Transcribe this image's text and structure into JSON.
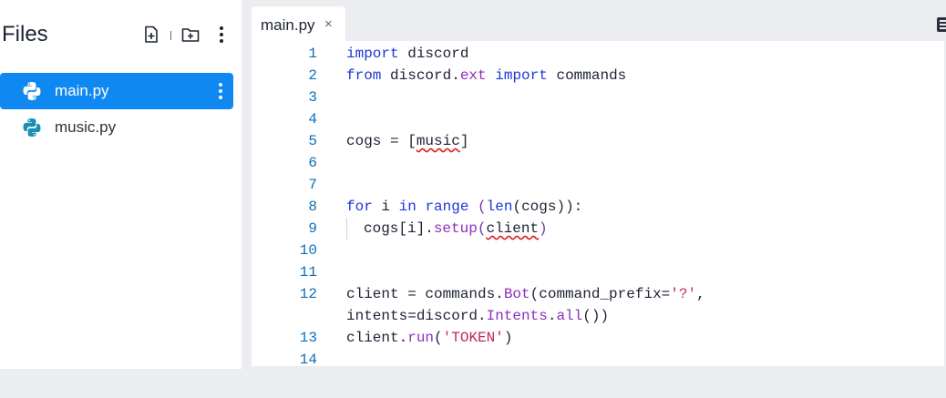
{
  "sidebar": {
    "title": "Files",
    "files": [
      {
        "name": "main.py",
        "active": true
      },
      {
        "name": "music.py",
        "active": false
      }
    ]
  },
  "tabs": [
    {
      "label": "main.py",
      "close": "×"
    }
  ],
  "editor": {
    "line_numbers": [
      "1",
      "2",
      "3",
      "4",
      "5",
      "6",
      "7",
      "8",
      "9",
      "10",
      "11",
      "12",
      "13",
      "14"
    ],
    "lines": {
      "l1": {
        "a": "import",
        "b": " discord"
      },
      "l2": {
        "a": "from",
        "b": " discord.",
        "c": "ext",
        "d": " ",
        "e": "import",
        "f": " commands"
      },
      "l5": {
        "a": "cogs = [",
        "b": "music",
        "c": "]"
      },
      "l8": {
        "a": "for",
        "b": " i ",
        "c": "in",
        "d": " ",
        "e": "range",
        "f": " (",
        "g": "len",
        "h": "(cogs)):"
      },
      "l9": {
        "a": "cogs[i].",
        "b": "setup",
        "c": "(",
        "d": "client",
        "e": ")"
      },
      "l12a": {
        "a": "client = commands.",
        "b": "Bot",
        "c": "(command_prefix=",
        "d": "'?'",
        "e": ","
      },
      "l12b": {
        "a": "intents=discord.",
        "b": "Intents",
        "c": ".",
        "d": "all",
        "e": "())"
      },
      "l13": {
        "a": "client.",
        "b": "run",
        "c": "(",
        "d": "'TOKEN'",
        "e": ")"
      }
    }
  },
  "colors": {
    "accent": "#0f88f2",
    "keyword": "#1f37d3",
    "function": "#8c2fbf",
    "string": "#c2285a",
    "line_number": "#0e6fb8"
  }
}
